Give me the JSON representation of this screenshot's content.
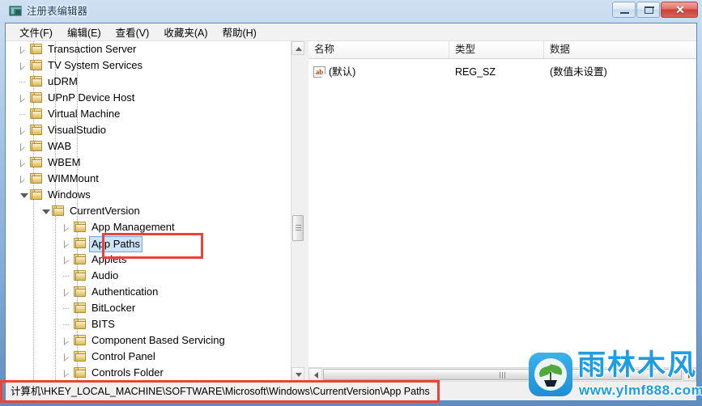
{
  "window": {
    "title": "注册表编辑器",
    "icon": "registry-editor-icon",
    "controls": {
      "minimize": "最小化",
      "maximize": "最大化",
      "close": "✕"
    }
  },
  "menubar": {
    "items": [
      {
        "label": "文件(F)"
      },
      {
        "label": "编辑(E)"
      },
      {
        "label": "查看(V)"
      },
      {
        "label": "收藏夹(A)"
      },
      {
        "label": "帮助(H)"
      }
    ]
  },
  "tree": {
    "nodes": [
      {
        "label": "Transaction Server",
        "depth": 1,
        "state": "collapsed",
        "selected": false
      },
      {
        "label": "TV System Services",
        "depth": 1,
        "state": "collapsed",
        "selected": false
      },
      {
        "label": "uDRM",
        "depth": 1,
        "state": "leaf",
        "selected": false
      },
      {
        "label": "UPnP Device Host",
        "depth": 1,
        "state": "collapsed",
        "selected": false
      },
      {
        "label": "Virtual Machine",
        "depth": 1,
        "state": "leaf",
        "selected": false
      },
      {
        "label": "VisualStudio",
        "depth": 1,
        "state": "collapsed",
        "selected": false
      },
      {
        "label": "WAB",
        "depth": 1,
        "state": "collapsed",
        "selected": false
      },
      {
        "label": "WBEM",
        "depth": 1,
        "state": "collapsed",
        "selected": false
      },
      {
        "label": "WIMMount",
        "depth": 1,
        "state": "collapsed",
        "selected": false
      },
      {
        "label": "Windows",
        "depth": 1,
        "state": "expanded",
        "selected": false
      },
      {
        "label": "CurrentVersion",
        "depth": 2,
        "state": "expanded",
        "selected": false
      },
      {
        "label": "App Management",
        "depth": 3,
        "state": "collapsed",
        "selected": false
      },
      {
        "label": "App Paths",
        "depth": 3,
        "state": "collapsed",
        "selected": true
      },
      {
        "label": "Applets",
        "depth": 3,
        "state": "collapsed",
        "selected": false
      },
      {
        "label": "Audio",
        "depth": 3,
        "state": "leaf",
        "selected": false
      },
      {
        "label": "Authentication",
        "depth": 3,
        "state": "collapsed",
        "selected": false
      },
      {
        "label": "BitLocker",
        "depth": 3,
        "state": "leaf",
        "selected": false
      },
      {
        "label": "BITS",
        "depth": 3,
        "state": "leaf",
        "selected": false
      },
      {
        "label": "Component Based Servicing",
        "depth": 3,
        "state": "collapsed",
        "selected": false
      },
      {
        "label": "Control Panel",
        "depth": 3,
        "state": "collapsed",
        "selected": false
      },
      {
        "label": "Controls Folder",
        "depth": 3,
        "state": "collapsed",
        "selected": false
      }
    ]
  },
  "list": {
    "columns": [
      {
        "label": "名称"
      },
      {
        "label": "类型"
      },
      {
        "label": "数据"
      }
    ],
    "rows": [
      {
        "icon": "string-value-icon",
        "name": "(默认)",
        "type": "REG_SZ",
        "data": "(数值未设置)"
      }
    ]
  },
  "statusbar": {
    "path": "计算机\\HKEY_LOCAL_MACHINE\\SOFTWARE\\Microsoft\\Windows\\CurrentVersion\\App Paths"
  },
  "watermark": {
    "brand": "雨林木风",
    "url": "www.ylmf888.com"
  },
  "annotations": {
    "highlight_color": "#e8443a",
    "boxes": [
      {
        "name": "app-paths-highlight"
      },
      {
        "name": "status-path-highlight"
      }
    ]
  }
}
